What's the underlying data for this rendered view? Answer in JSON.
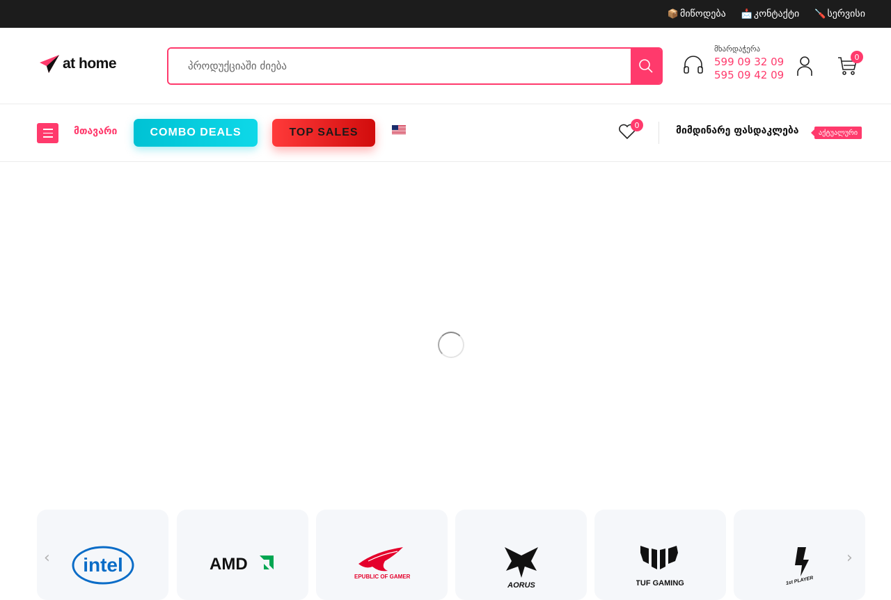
{
  "topbar": {
    "links": [
      {
        "icon": "package-icon",
        "glyph": "📦",
        "label": "მიწოდება"
      },
      {
        "icon": "mailbox-icon",
        "glyph": "📩",
        "label": "კონტაქტი"
      },
      {
        "icon": "screwdriver-icon",
        "glyph": "🪛",
        "label": "სერვისი"
      }
    ]
  },
  "header": {
    "logo_text": "at home",
    "search_placeholder": "პროდუქციაში ძიება",
    "support_label": "მხარდაჭერა",
    "phone_1": "599 09 32 09",
    "phone_2": "595 09 42 09",
    "cart_count": "0"
  },
  "nav": {
    "home_label": "მთავარი",
    "combo_label": "COMBO DEALS",
    "topsales_label": "TOP SALES",
    "wishlist_count": "0",
    "sales_label": "მიმდინარე ფასდაკლება",
    "sales_tag": "აქტუალური"
  },
  "brands": [
    "intel",
    "AMD",
    "REPUBLIC OF GAMERS",
    "AORUS",
    "TUF GAMING",
    "1st PLAYER"
  ],
  "colors": {
    "accent": "#ff3a6c",
    "topbar": "#1c1c1c",
    "combo": "#00c2d4",
    "topsales": "#e01515"
  }
}
